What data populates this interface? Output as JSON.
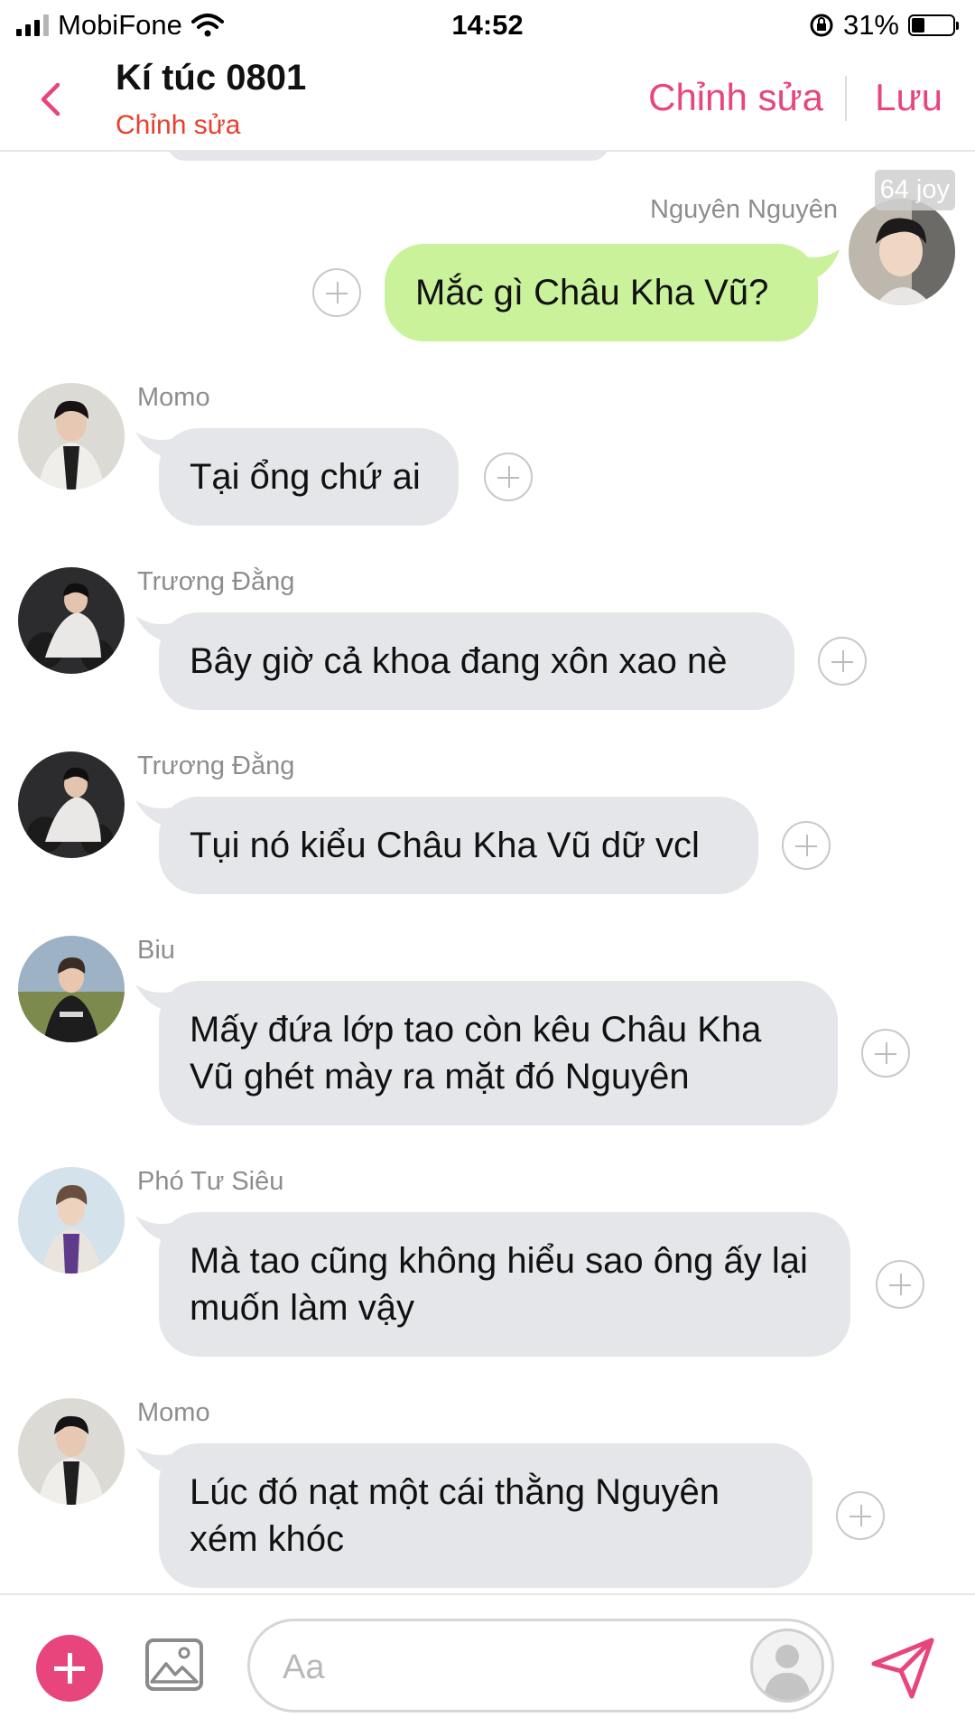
{
  "status_bar": {
    "carrier": "MobiFone",
    "time": "14:52",
    "battery": "31%",
    "battery_fraction": 0.31
  },
  "header": {
    "title": "Kí túc 0801",
    "subtitle": "Chỉnh sửa",
    "edit_label": "Chỉnh sửa",
    "save_label": "Lưu"
  },
  "messages": [
    {
      "sender": "Nguyên Nguyên",
      "text": "Mắc gì Châu Kha Vũ?",
      "side": "out",
      "badge": "64 joy"
    },
    {
      "sender": "Momo",
      "text": "Tại ổng chứ ai",
      "side": "in"
    },
    {
      "sender": "Trương Đằng",
      "text": "Bây giờ cả khoa đang xôn xao nè",
      "side": "in"
    },
    {
      "sender": "Trương Đằng",
      "text": "Tụi nó kiểu Châu Kha Vũ dữ vcl",
      "side": "in"
    },
    {
      "sender": "Biu",
      "text": "Mấy đứa lớp tao còn kêu Châu Kha Vũ ghét mày ra mặt đó Nguyên",
      "side": "in"
    },
    {
      "sender": "Phó Tư Siêu",
      "text": "Mà tao cũng không hiểu sao ông ấy lại muốn làm vậy",
      "side": "in"
    },
    {
      "sender": "Momo",
      "text": "Lúc đó nạt một cái thằng Nguyên xém khóc",
      "side": "in"
    }
  ],
  "composer": {
    "placeholder": "Aa"
  },
  "colors": {
    "accent": "#e8457c",
    "subtitle": "#e8402e",
    "out_bubble": "#c9f29a",
    "in_bubble": "#e5e6ea"
  },
  "icons": {
    "back": "chevron-left-icon",
    "add": "plus-circle-icon",
    "image": "image-icon",
    "persona": "person-icon",
    "send": "send-icon",
    "react": "plus-icon"
  }
}
